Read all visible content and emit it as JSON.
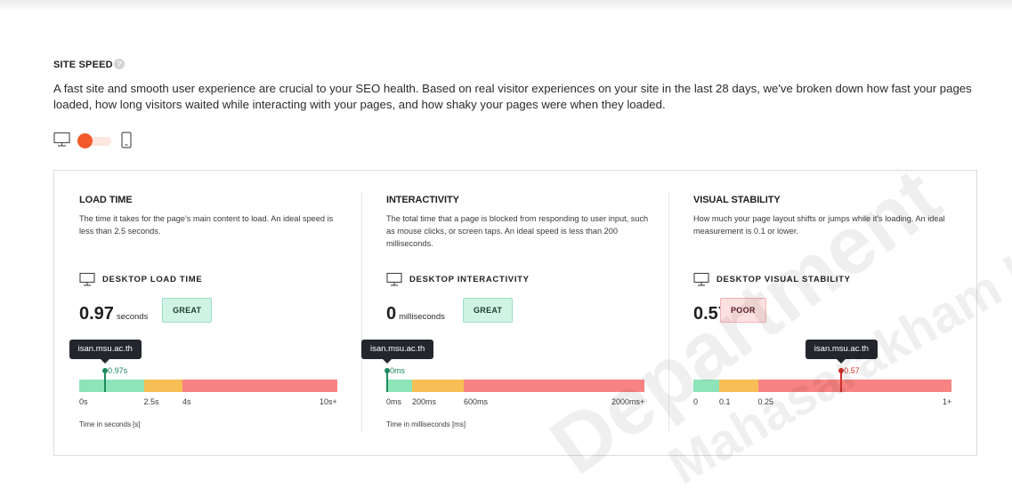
{
  "section": {
    "title": "SITE SPEED",
    "help_icon": "help-circle-icon",
    "intro": "A fast site and smooth user experience are crucial to your SEO health. Based on real visitor experiences on your site in the last 28 days, we've broken down how fast your pages loaded, how long visitors waited while interacting with your pages, and how shaky your pages were when they loaded."
  },
  "device_toggle": {
    "left_icon": "desktop-icon",
    "right_icon": "mobile-icon",
    "selected": "desktop"
  },
  "colors": {
    "good": "#8de4b9",
    "needs_improvement": "#f6be55",
    "poor": "#f88383",
    "accent": "#f25a2c",
    "marker_good": "#1e8a5c",
    "marker_poor": "#d2322d"
  },
  "load_time": {
    "title": "LOAD TIME",
    "description": "The time it takes for the page's main content to load. An ideal speed is less than 2.5 seconds.",
    "subtitle": "DESKTOP LOAD TIME",
    "value": "0.97",
    "unit": "seconds",
    "badge": "GREAT",
    "site": "isan.msu.ac.th",
    "marker_label": "0.97s",
    "marker_fraction": 0.097,
    "segments": [
      0.25,
      0.15,
      0.6
    ],
    "ticks": [
      {
        "label": "0s",
        "frac": 0
      },
      {
        "label": "2.5s",
        "frac": 0.25
      },
      {
        "label": "4s",
        "frac": 0.4
      },
      {
        "label": "10s+",
        "frac": 1
      }
    ],
    "axis_note": "Time in seconds [s]"
  },
  "interactivity": {
    "title": "INTERACTIVITY",
    "description": "The total time that a page is blocked from responding to user input, such as mouse clicks, or screen taps. An ideal speed is less than 200 milliseconds.",
    "subtitle": "DESKTOP INTERACTIVITY",
    "value": "0",
    "unit": "milliseconds",
    "badge": "GREAT",
    "site": "isan.msu.ac.th",
    "marker_label": "0ms",
    "marker_fraction": 0,
    "segments": [
      0.1,
      0.2,
      0.7
    ],
    "ticks": [
      {
        "label": "0ms",
        "frac": 0
      },
      {
        "label": "200ms",
        "frac": 0.1
      },
      {
        "label": "600ms",
        "frac": 0.3
      },
      {
        "label": "2000ms+",
        "frac": 1
      }
    ],
    "axis_note": "Time in milliseconds [ms]"
  },
  "visual_stability": {
    "title": "VISUAL STABILITY",
    "description": "How much your page layout shifts or jumps while it's loading. An ideal measurement is 0.1 or lower.",
    "subtitle": "DESKTOP VISUAL STABILITY",
    "value": "0.57",
    "unit": "",
    "badge": "POOR",
    "site": "isan.msu.ac.th",
    "marker_label": "0.57",
    "marker_fraction": 0.57,
    "segments": [
      0.1,
      0.15,
      0.75
    ],
    "ticks": [
      {
        "label": "0",
        "frac": 0
      },
      {
        "label": "0.1",
        "frac": 0.1
      },
      {
        "label": "0.25",
        "frac": 0.25
      },
      {
        "label": "1+",
        "frac": 1
      }
    ],
    "axis_note": ""
  },
  "watermark": {
    "line1": "Department",
    "line2": "Mahasarakham University"
  }
}
